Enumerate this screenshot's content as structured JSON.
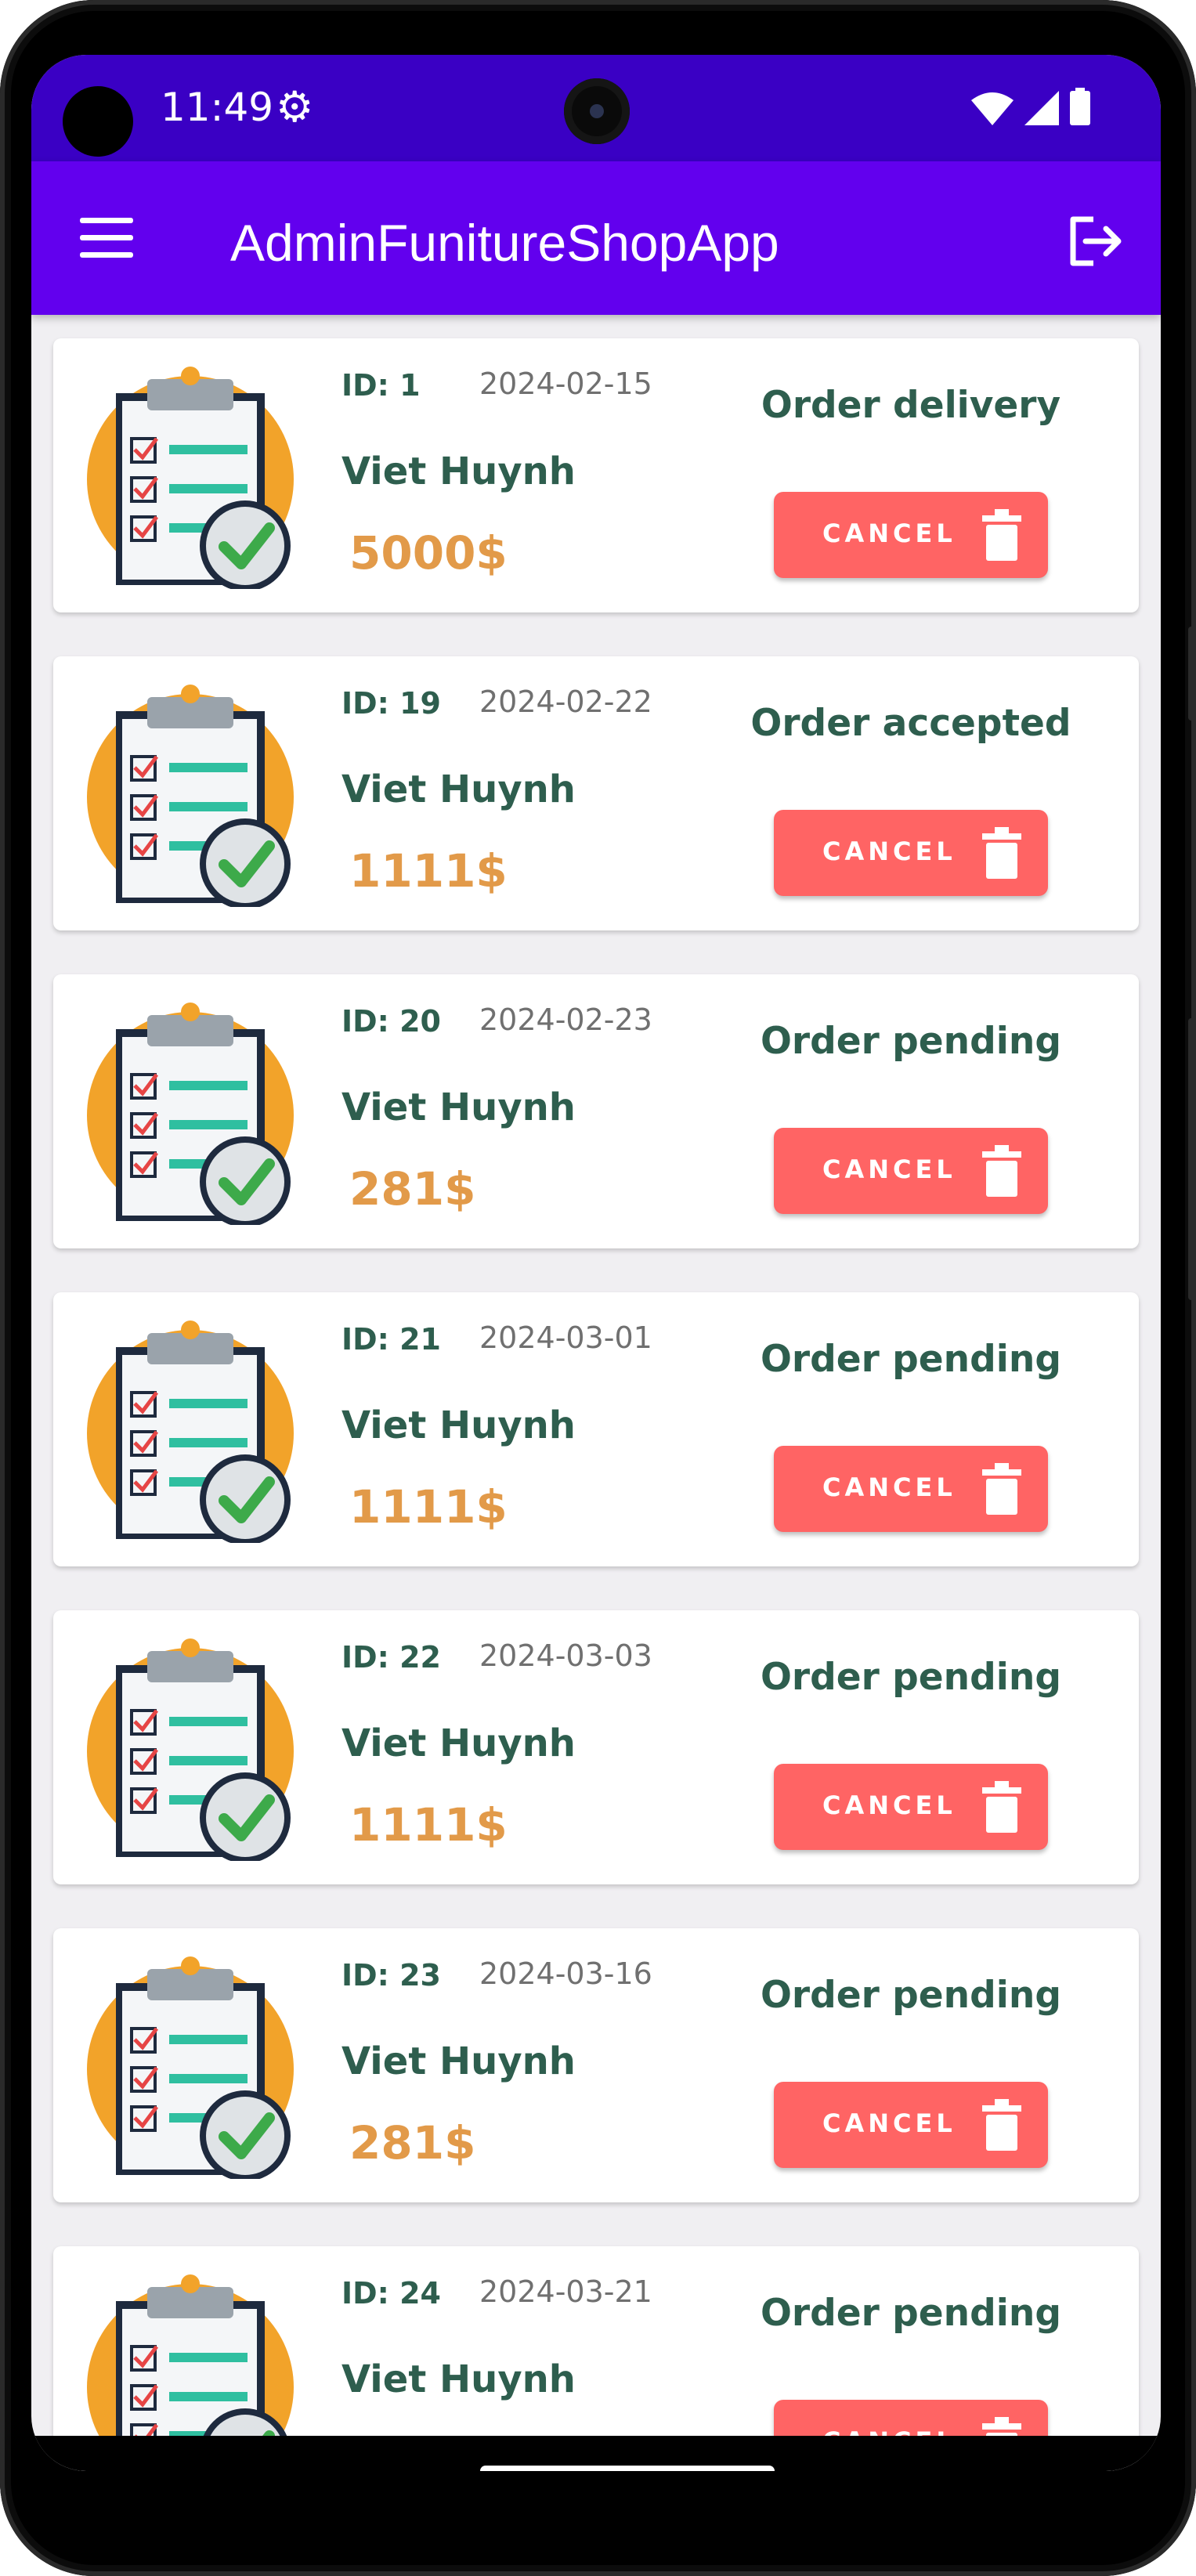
{
  "status_bar": {
    "time": "11:49"
  },
  "app_bar": {
    "title": "AdminFunitureShopApp"
  },
  "orders": [
    {
      "id_label": "ID: 1",
      "date": "2024-02-15",
      "customer": "Viet Huynh",
      "price": "5000$",
      "status": "Order delivery",
      "cancel_label": "CANCEL"
    },
    {
      "id_label": "ID: 19",
      "date": "2024-02-22",
      "customer": "Viet Huynh",
      "price": "1111$",
      "status": "Order accepted",
      "cancel_label": "CANCEL"
    },
    {
      "id_label": "ID: 20",
      "date": "2024-02-23",
      "customer": "Viet Huynh",
      "price": "281$",
      "status": "Order pending",
      "cancel_label": "CANCEL"
    },
    {
      "id_label": "ID: 21",
      "date": "2024-03-01",
      "customer": "Viet Huynh",
      "price": "1111$",
      "status": "Order pending",
      "cancel_label": "CANCEL"
    },
    {
      "id_label": "ID: 22",
      "date": "2024-03-03",
      "customer": "Viet Huynh",
      "price": "1111$",
      "status": "Order pending",
      "cancel_label": "CANCEL"
    },
    {
      "id_label": "ID: 23",
      "date": "2024-03-16",
      "customer": "Viet Huynh",
      "price": "281$",
      "status": "Order pending",
      "cancel_label": "CANCEL"
    },
    {
      "id_label": "ID: 24",
      "date": "2024-03-21",
      "customer": "Viet Huynh",
      "price": "",
      "status": "Order pending",
      "cancel_label": "CANCEL"
    }
  ],
  "colors": {
    "status_bar": "#3a00c4",
    "app_bar": "#6200ee",
    "cancel_button": "#ff6464",
    "price": "#e29a49",
    "text_primary": "#2e5e4e"
  },
  "icons": {
    "menu": "hamburger-menu-icon",
    "logout": "logout-icon",
    "settings": "gear-icon",
    "order": "clipboard-check-icon",
    "trash": "trash-icon"
  }
}
